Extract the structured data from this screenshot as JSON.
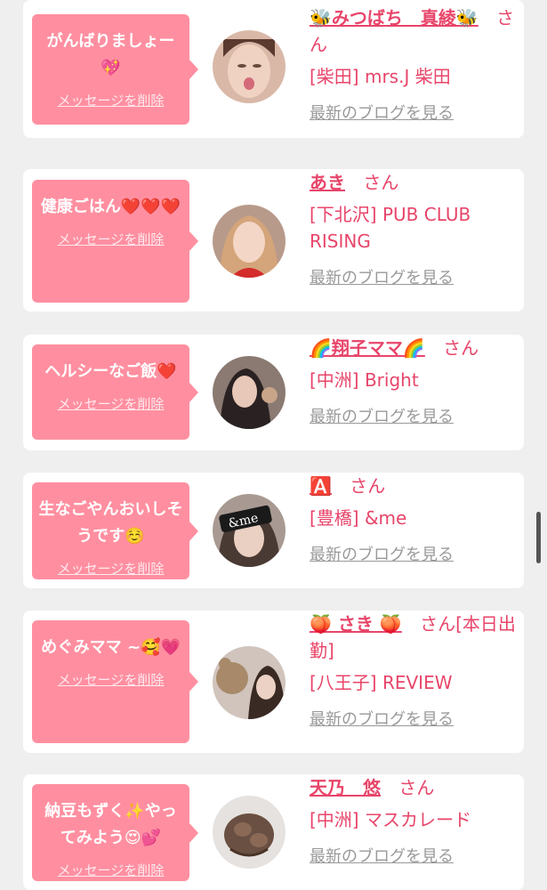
{
  "cards": [
    {
      "message": "がんばりましょー💖",
      "delete_label": "メッセージを削除",
      "name": "🐝みつばち　真綾🐝",
      "san": "さん",
      "shop": "[柴田] mrs.J 柴田",
      "blog_label": "最新のブログを見る",
      "avatar_desc": "woman avatar"
    },
    {
      "message": "健康ごはん❤️❤️❤️",
      "delete_label": "メッセージを削除",
      "name": "あき",
      "san": "さん",
      "shop": "[下北沢] PUB CLUB RISING",
      "blog_label": "最新のブログを見る",
      "avatar_desc": "woman avatar"
    },
    {
      "message": "ヘルシーなご飯❤️",
      "delete_label": "メッセージを削除",
      "name": "🌈翔子ママ🌈",
      "san": "さん",
      "shop": "[中洲] Bright",
      "blog_label": "最新のブログを見る",
      "avatar_desc": "woman avatar"
    },
    {
      "message": "生なごやんおいしそうです☺️",
      "delete_label": "メッセージを削除",
      "name": "🅰️",
      "san": "さん",
      "shop": "[豊橋] &me",
      "blog_label": "最新のブログを見る",
      "avatar_desc": "woman avatar with &me label"
    },
    {
      "message": "めぐみママ ~🥰💗",
      "delete_label": "メッセージを削除",
      "name": "🍑 さき 🍑",
      "san": "さん[本日出勤]",
      "shop": "[八王子] REVIEW",
      "blog_label": "最新のブログを見る",
      "avatar_desc": "woman avatar"
    },
    {
      "message": "納豆もずく✨やってみよう😍💕",
      "delete_label": "メッセージを削除",
      "name": "天乃　悠",
      "san": "さん",
      "shop": "[中洲] マスカレード",
      "blog_label": "最新のブログを見る",
      "avatar_desc": "hair style avatar"
    }
  ],
  "avatar_icons": [
    "avatar-1-icon",
    "avatar-2-icon",
    "avatar-3-icon",
    "avatar-4-icon",
    "avatar-5-icon",
    "avatar-6-icon"
  ],
  "colors": {
    "bubble": "#ff8fa0",
    "accent_text": "#e8456a",
    "link_gray": "#999999",
    "background": "#efefef"
  }
}
